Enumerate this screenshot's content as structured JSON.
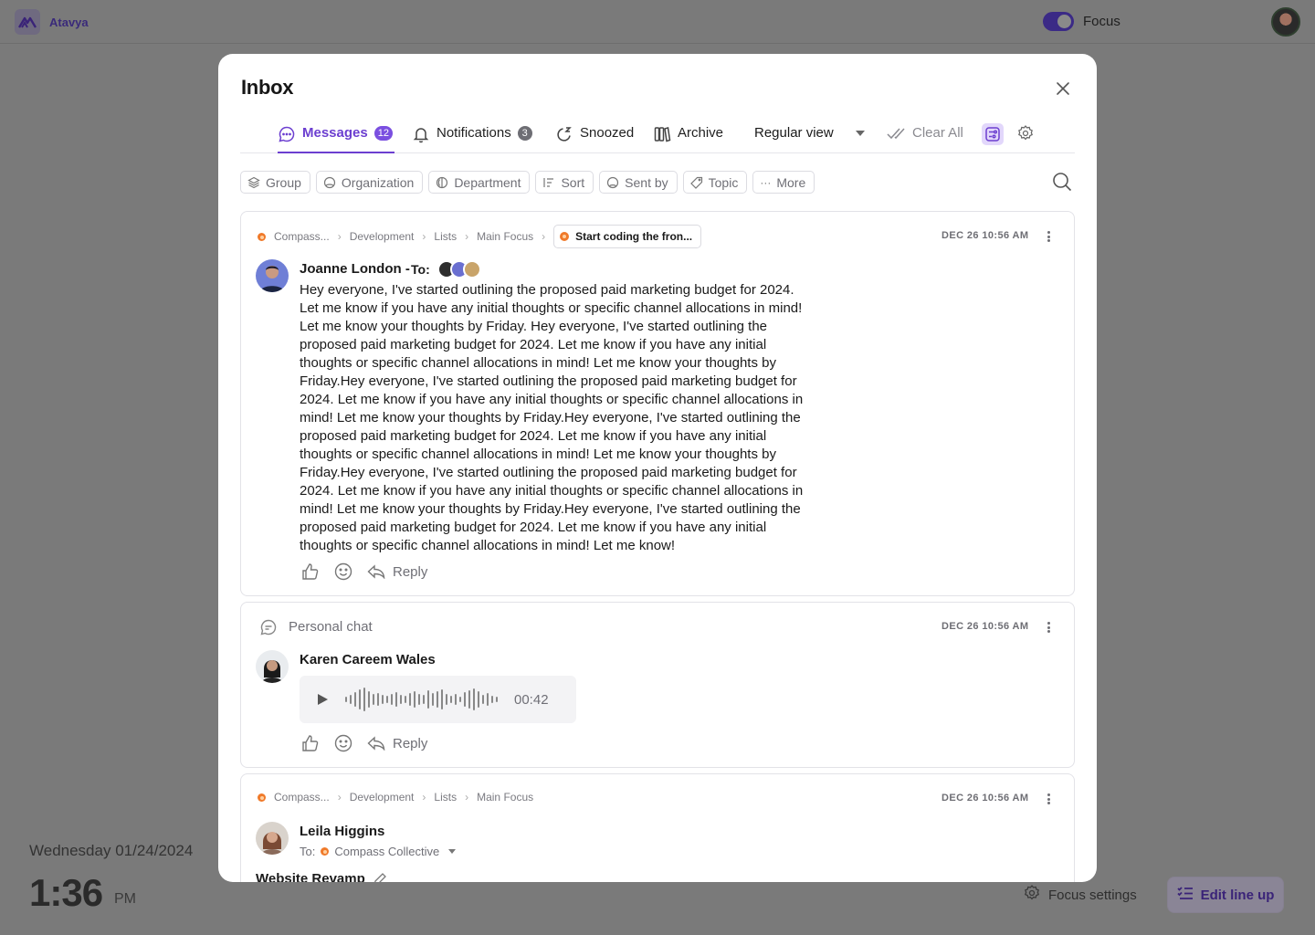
{
  "app": {
    "name": "Atavya",
    "focus_label": "Focus"
  },
  "background": {
    "date": "Wednesday 01/24/2024",
    "time": "1:36",
    "ampm": "PM",
    "focus_settings": "Focus settings",
    "edit_lineup": "Edit line up"
  },
  "inbox": {
    "title": "Inbox",
    "tabs": [
      {
        "label": "Messages",
        "badge": "12"
      },
      {
        "label": "Notifications",
        "badge": "3"
      },
      {
        "label": "Snoozed"
      },
      {
        "label": "Archive"
      }
    ],
    "view_select": "Regular view",
    "clear_all": "Clear All",
    "filters": [
      "Group",
      "Organization",
      "Department",
      "Sort",
      "Sent by",
      "Topic",
      "More"
    ]
  },
  "messages": [
    {
      "breadcrumb": [
        "Compass...",
        "Development",
        "Lists",
        "Main Focus"
      ],
      "task": "Start coding the fron...",
      "timestamp": "DEC 26 10:56 AM",
      "sender": "Joanne London -",
      "to_label": "To:",
      "body": "Hey everyone, I've started outlining the proposed paid marketing budget for 2024. Let me know if you have any initial thoughts or specific channel allocations in mind! Let me know your thoughts by Friday. Hey everyone, I've started outlining the proposed paid marketing budget for 2024. Let me know if you have any initial thoughts or specific channel allocations in mind! Let me know your thoughts by Friday.Hey everyone, I've started outlining the proposed paid marketing budget for 2024. Let me know if you have any initial thoughts or specific channel allocations in mind! Let me know your thoughts by Friday.Hey everyone, I've started outlining the proposed paid marketing budget for 2024. Let me know if you have any initial thoughts or specific channel allocations in mind! Let me know your thoughts by Friday.Hey everyone, I've started outlining the proposed paid marketing budget for 2024. Let me know if you have any initial thoughts or specific channel allocations in mind! Let me know your thoughts by Friday.Hey everyone, I've started outlining the proposed paid marketing budget for 2024. Let me know if you have any initial thoughts or specific channel allocations in mind! Let me know!",
      "reply_label": "Reply"
    },
    {
      "chat_label": "Personal chat",
      "timestamp": "DEC 26 10:56 AM",
      "sender": "Karen Careem Wales",
      "audio_duration": "00:42",
      "reply_label": "Reply"
    },
    {
      "breadcrumb": [
        "Compass...",
        "Development",
        "Lists",
        "Main Focus"
      ],
      "timestamp": "DEC 26 10:56 AM",
      "sender": "Leila Higgins",
      "to_label": "To:",
      "to_org": "Compass Collective",
      "subject": "Website Revamp"
    }
  ],
  "colors": {
    "accent": "#6c3fd0",
    "badge_gray": "#6e6e74",
    "org": "#f07a2a"
  }
}
